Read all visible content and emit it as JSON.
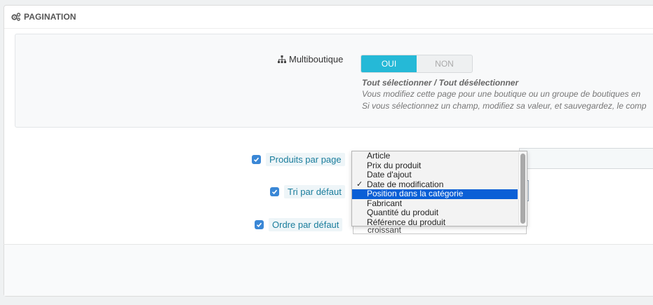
{
  "panel": {
    "title": "PAGINATION"
  },
  "multistore": {
    "label": "Multiboutique",
    "toggle": {
      "on_label": "OUI",
      "off_label": "NON",
      "selected": "OUI"
    },
    "help_title": "Tout sélectionner / Tout désélectionner",
    "help_line1": "Vous modifiez cette page pour une boutique ou un groupe de boutiques en",
    "help_line2": "Si vous sélectionnez un champ, modifiez sa valeur, et sauvegardez, le comp"
  },
  "fields": {
    "products_per_page": "Produits par page",
    "default_sort": "Tri par défaut",
    "default_order": "Ordre par défaut",
    "default_order_value": "croissant"
  },
  "sort_options": [
    {
      "label": "Article"
    },
    {
      "label": "Prix du produit"
    },
    {
      "label": "Date d'ajout"
    },
    {
      "label": "Date de modification",
      "check": "✓"
    },
    {
      "label": "Position dans la catégorie"
    },
    {
      "label": "Fabricant"
    },
    {
      "label": "Quantité du produit"
    },
    {
      "label": "Référence du produit"
    }
  ],
  "colors": {
    "accent": "#25b9d7",
    "selection": "#0a5fd6",
    "checkbox": "#3a87d6"
  },
  "icons": {
    "heading": "cogs-icon",
    "multistore": "sitemap-icon",
    "checkbox": "checkmark-icon"
  }
}
